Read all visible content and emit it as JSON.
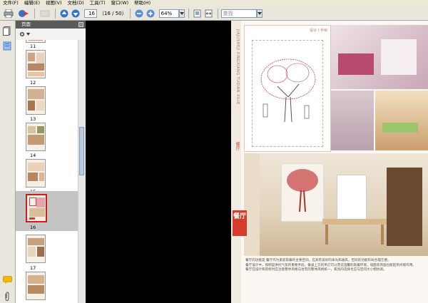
{
  "menu": [
    "文件(F)",
    "编辑(E)",
    "视图(V)",
    "文档(D)",
    "工具(T)",
    "窗口(W)",
    "帮助(H)"
  ],
  "toolbar": {
    "page_number": "16",
    "page_total": "（16 / 50）",
    "zoom": "64%",
    "search_placeholder": "查找"
  },
  "panel": {
    "title": "页面",
    "thumbnails": [
      {
        "label": "11",
        "selected": false
      },
      {
        "label": "12",
        "selected": false
      },
      {
        "label": "13",
        "selected": false
      },
      {
        "label": "14",
        "selected": false
      },
      {
        "label": "15",
        "selected": false
      },
      {
        "label": "16",
        "selected": true
      },
      {
        "label": "17",
        "selected": false
      },
      {
        "label": "",
        "selected": false
      }
    ]
  },
  "document": {
    "section_title": "餐厅",
    "caption_top": "设计 / 手绘",
    "vertical_text": "JIAJUSHEJI XINGXIANG TUDIAN XILIE",
    "side_label": "餐厅",
    "body_paragraphs": [
      "餐厅的功能是 餐厅作为家庭就餐的主要空间，应具有良好的采光和通风，空间的功能布局合理方便。",
      "餐厅设计中，照明是烘托气氛的重要手段。餐桌上方的吊灯可以营造温馨的就餐环境，墙面装饰画也能起到点缀作用。",
      "餐厅在设计和装修时应注意整体风格与住宅的整体风格统一，家具的选择也应与空间大小相协调。"
    ]
  },
  "colors": {
    "accent_red": "#d63c2c",
    "panel_header": "#5a5a5a",
    "toolbar_bg": "#e8e6dd"
  }
}
